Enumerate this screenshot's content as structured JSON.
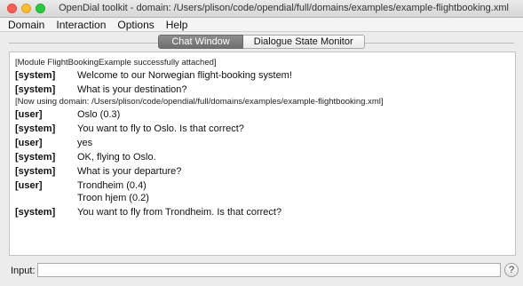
{
  "window": {
    "title": "OpenDial toolkit - domain: /Users/plison/code/opendial/full/domains/examples/example-flightbooking.xml"
  },
  "menu": {
    "items": [
      "Domain",
      "Interaction",
      "Options",
      "Help"
    ]
  },
  "tabs": [
    {
      "label": "Chat Window",
      "active": true
    },
    {
      "label": "Dialogue State Monitor",
      "active": false
    }
  ],
  "chat": {
    "attach_notice": "[Module FlightBookingExample successfully attached]",
    "domain_notice": "[Now using domain: /Users/plison/code/opendial/full/domains/examples/example-flightbooking.xml]",
    "messages": [
      {
        "speaker": "[system]",
        "lines": [
          "Welcome to our Norwegian flight-booking system!"
        ]
      },
      {
        "speaker": "[system]",
        "lines": [
          "What is your destination?"
        ]
      },
      {
        "speaker": "[user]",
        "lines": [
          "Oslo (0.3)"
        ]
      },
      {
        "speaker": "[system]",
        "lines": [
          "You want to fly to Oslo. Is that correct?"
        ]
      },
      {
        "speaker": "[user]",
        "lines": [
          "yes"
        ]
      },
      {
        "speaker": "[system]",
        "lines": [
          "OK, flying to Oslo."
        ]
      },
      {
        "speaker": "[system]",
        "lines": [
          "What is your departure?"
        ]
      },
      {
        "speaker": "[user]",
        "lines": [
          "Trondheim (0.4)",
          "Troon hjem (0.2)"
        ]
      },
      {
        "speaker": "[system]",
        "lines": [
          "You want to fly from Trondheim. Is that correct?"
        ]
      }
    ]
  },
  "input": {
    "label": "Input:",
    "value": "",
    "help_label": "?"
  }
}
